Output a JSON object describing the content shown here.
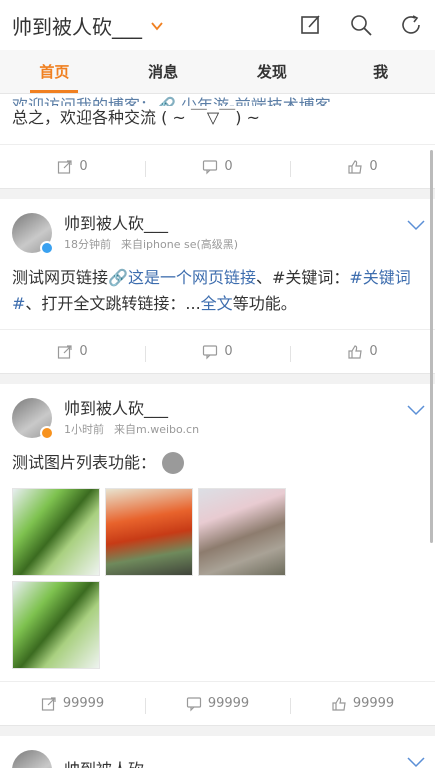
{
  "header": {
    "title": "帅到被人砍___"
  },
  "tabs": [
    {
      "label": "首页"
    },
    {
      "label": "消息"
    },
    {
      "label": "发现"
    },
    {
      "label": "我"
    }
  ],
  "posts": [
    {
      "text_clip": "欢迎访问我的博客：🔗 少年游-前端技术博客",
      "text": "总之，欢迎各种交流 ( ~ ￣▽￣) ~",
      "actions": {
        "repost": "0",
        "comment": "0",
        "like": "0"
      }
    },
    {
      "author": "帅到被人砍___",
      "time": "18分钟前",
      "source": "来自iphone se(高级黑)",
      "content": {
        "p1": "测试网页链接",
        "l1": "🔗这是一个网页链接",
        "p2": "、#关键词：",
        "l2": "#关键词#",
        "p3": "、打开全文跳转链接：...",
        "l3": "全文",
        "p4": "等功能。"
      },
      "actions": {
        "repost": "0",
        "comment": "0",
        "like": "0"
      }
    },
    {
      "author": "帅到被人砍___",
      "time": "1小时前",
      "source": "来自m.weibo.cn",
      "content": "测试图片列表功能：",
      "actions": {
        "repost": "99999",
        "comment": "99999",
        "like": "99999"
      }
    },
    {
      "author": "帅到被人砍"
    }
  ],
  "colors": {
    "accent": "#f08021",
    "link": "#3d6dae"
  }
}
